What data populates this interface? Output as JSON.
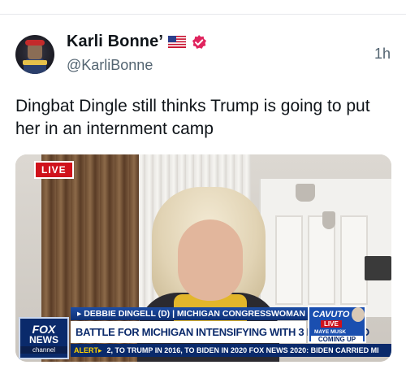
{
  "post": {
    "display_name": "Karli Bonne’",
    "handle": "@KarliBonne",
    "time": "1h",
    "text": "Dingbat Dingle still thinks Trump is going to put her in an internment camp",
    "flag_icon": "us-flag-icon",
    "verified_icon": "verified-badge-icon",
    "verified_color": "#e0245e"
  },
  "media": {
    "live_label": "LIVE",
    "name_strap": "▸ DEBBIE DINGELL (D) | MICHIGAN CONGRESSWOMAN",
    "headline": "BATTLE FOR MICHIGAN INTENSIFYING WITH 3 DAYS TO GO",
    "alert_label": "ALERT▸",
    "alert_text": "2, TO TRUMP IN 2016, TO BIDEN IN 2020   FOX NEWS  2020: BIDEN CARRIED MI",
    "logo": {
      "line1": "FOX",
      "line2": "NEWS",
      "line3": "channel"
    },
    "promo": {
      "show": "CAVUTO",
      "live": "LIVE",
      "guest": "MAYE MUSK",
      "coming": "COMING UP"
    }
  }
}
